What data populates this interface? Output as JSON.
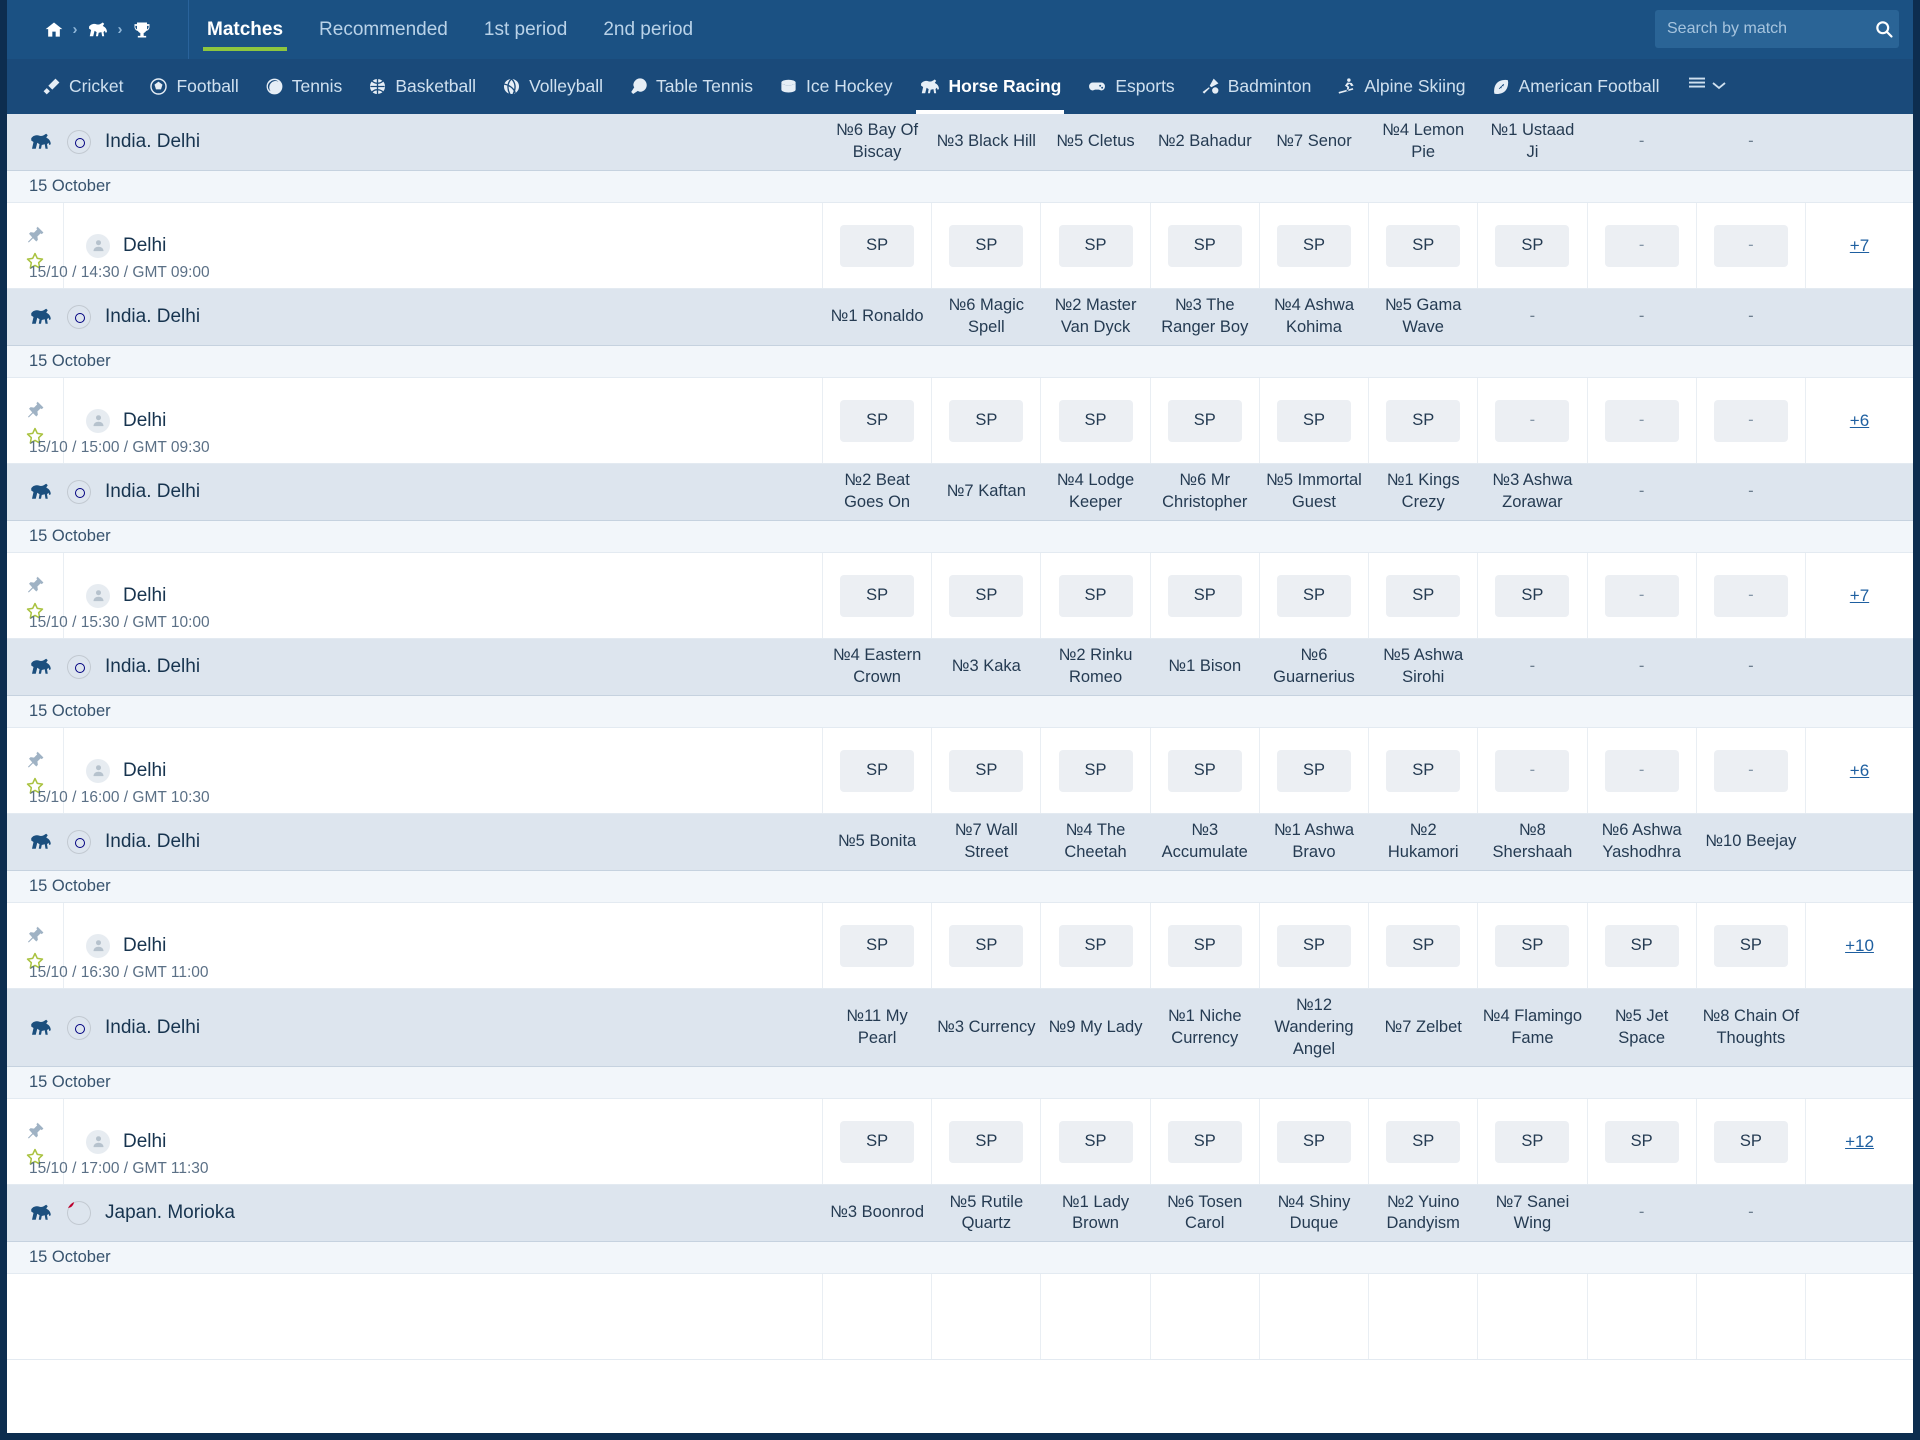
{
  "header": {
    "breadcrumb": [
      "home-icon",
      "horse-icon",
      "trophy-icon"
    ],
    "tabs": [
      {
        "label": "Matches",
        "active": true
      },
      {
        "label": "Recommended",
        "active": false
      },
      {
        "label": "1st period",
        "active": false
      },
      {
        "label": "2nd period",
        "active": false
      }
    ],
    "search": {
      "placeholder": "Search by match",
      "value": ""
    }
  },
  "sports": [
    {
      "label": "Cricket",
      "icon": "cricket-icon",
      "active": false
    },
    {
      "label": "Football",
      "icon": "football-icon",
      "active": false
    },
    {
      "label": "Tennis",
      "icon": "tennis-icon",
      "active": false
    },
    {
      "label": "Basketball",
      "icon": "basketball-icon",
      "active": false
    },
    {
      "label": "Volleyball",
      "icon": "volleyball-icon",
      "active": false
    },
    {
      "label": "Table Tennis",
      "icon": "table-tennis-icon",
      "active": false
    },
    {
      "label": "Ice Hockey",
      "icon": "ice-hockey-icon",
      "active": false
    },
    {
      "label": "Horse Racing",
      "icon": "horse-racing-icon",
      "active": true
    },
    {
      "label": "Esports",
      "icon": "esports-icon",
      "active": false
    },
    {
      "label": "Badminton",
      "icon": "badminton-icon",
      "active": false
    },
    {
      "label": "Alpine Skiing",
      "icon": "alpine-skiing-icon",
      "active": false
    },
    {
      "label": "American Football",
      "icon": "american-football-icon",
      "active": false
    }
  ],
  "sports_more_icon": "hamburger-menu-icon",
  "common": {
    "sp_label": "SP",
    "empty_label": "-",
    "date_label": "15 October",
    "team_name": "Delhi"
  },
  "races": [
    {
      "country": "India. Delhi",
      "flag": "india",
      "date": "15 October",
      "team": "Delhi",
      "time": "15/10 / 14:30 / GMT 09:00",
      "more": "+7",
      "runners": [
        "№6 Bay Of Biscay",
        "№3 Black Hill",
        "№5 Cletus",
        "№2 Bahadur",
        "№7 Senor",
        "№4 Lemon Pie",
        "№1 Ustaad Ji",
        "-",
        "-"
      ],
      "odds": [
        "SP",
        "SP",
        "SP",
        "SP",
        "SP",
        "SP",
        "SP",
        "-",
        "-"
      ]
    },
    {
      "country": "India. Delhi",
      "flag": "india",
      "date": "15 October",
      "team": "Delhi",
      "time": "15/10 / 15:00 / GMT 09:30",
      "more": "+6",
      "runners": [
        "№1 Ronaldo",
        "№6 Magic Spell",
        "№2 Master Van Dyck",
        "№3 The Ranger Boy",
        "№4 Ashwa Kohima",
        "№5 Gama Wave",
        "-",
        "-",
        "-"
      ],
      "odds": [
        "SP",
        "SP",
        "SP",
        "SP",
        "SP",
        "SP",
        "-",
        "-",
        "-"
      ]
    },
    {
      "country": "India. Delhi",
      "flag": "india",
      "date": "15 October",
      "team": "Delhi",
      "time": "15/10 / 15:30 / GMT 10:00",
      "more": "+7",
      "runners": [
        "№2 Beat Goes On",
        "№7 Kaftan",
        "№4 Lodge Keeper",
        "№6 Mr Christopher",
        "№5 Immortal Guest",
        "№1 Kings Crezy",
        "№3 Ashwa Zorawar",
        "-",
        "-"
      ],
      "odds": [
        "SP",
        "SP",
        "SP",
        "SP",
        "SP",
        "SP",
        "SP",
        "-",
        "-"
      ]
    },
    {
      "country": "India. Delhi",
      "flag": "india",
      "date": "15 October",
      "team": "Delhi",
      "time": "15/10 / 16:00 / GMT 10:30",
      "more": "+6",
      "runners": [
        "№4 Eastern Crown",
        "№3 Kaka",
        "№2 Rinku Romeo",
        "№1 Bison",
        "№6 Guarnerius",
        "№5 Ashwa Sirohi",
        "-",
        "-",
        "-"
      ],
      "odds": [
        "SP",
        "SP",
        "SP",
        "SP",
        "SP",
        "SP",
        "-",
        "-",
        "-"
      ]
    },
    {
      "country": "India. Delhi",
      "flag": "india",
      "date": "15 October",
      "team": "Delhi",
      "time": "15/10 / 16:30 / GMT 11:00",
      "more": "+10",
      "runners": [
        "№5 Bonita",
        "№7 Wall Street",
        "№4 The Cheetah",
        "№3 Accumulate",
        "№1 Ashwa Bravo",
        "№2 Hukamori",
        "№8 Shershaah",
        "№6 Ashwa Yashodhra",
        "№10 Beejay"
      ],
      "odds": [
        "SP",
        "SP",
        "SP",
        "SP",
        "SP",
        "SP",
        "SP",
        "SP",
        "SP"
      ]
    },
    {
      "country": "India. Delhi",
      "flag": "india",
      "date": "15 October",
      "team": "Delhi",
      "time": "15/10 / 17:00 / GMT 11:30",
      "more": "+12",
      "runners": [
        "№11 My Pearl",
        "№3 Currency",
        "№9 My Lady",
        "№1 Niche Currency",
        "№12 Wandering Angel",
        "№7 Zelbet",
        "№4 Flamingo Fame",
        "№5 Jet Space",
        "№8 Chain Of Thoughts"
      ],
      "odds": [
        "SP",
        "SP",
        "SP",
        "SP",
        "SP",
        "SP",
        "SP",
        "SP",
        "SP"
      ]
    },
    {
      "country": "Japan. Morioka",
      "flag": "japan",
      "date": "15 October",
      "team": "",
      "time": "",
      "more": "",
      "runners": [
        "№3 Boonrod",
        "№5 Rutile Quartz",
        "№1 Lady Brown",
        "№6 Tosen Carol",
        "№4 Shiny Duque",
        "№2 Yuino Dandyism",
        "№7 Sanei Wing",
        "-",
        "-"
      ],
      "odds": []
    }
  ]
}
